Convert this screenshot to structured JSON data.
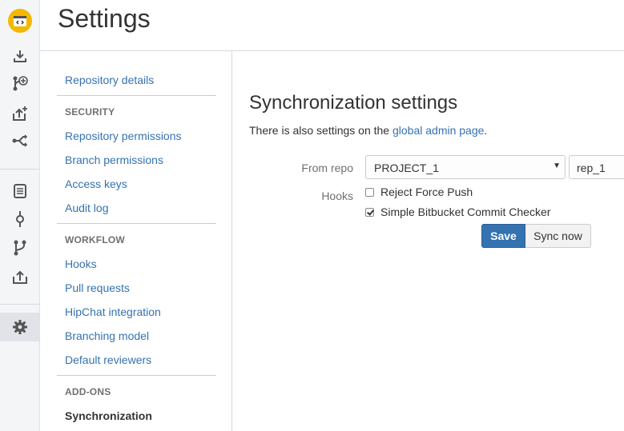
{
  "header": {
    "title": "Settings"
  },
  "rail": {
    "icons": [
      "bitbucket-logo-icon",
      "clone-icon",
      "create-branch-icon",
      "create-pull-request-icon",
      "fork-icon",
      "source-icon",
      "commits-icon",
      "branches-icon",
      "pull-requests-icon",
      "settings-gear-icon"
    ]
  },
  "nav": {
    "repository_details": "Repository details",
    "sections": [
      {
        "heading": "SECURITY",
        "items": [
          "Repository permissions",
          "Branch permissions",
          "Access keys",
          "Audit log"
        ]
      },
      {
        "heading": "WORKFLOW",
        "items": [
          "Hooks",
          "Pull requests",
          "HipChat integration",
          "Branching model",
          "Default reviewers"
        ]
      },
      {
        "heading": "ADD-ONS",
        "items": [
          "Synchronization"
        ]
      }
    ],
    "current": "Synchronization"
  },
  "main": {
    "title": "Synchronization settings",
    "info_prefix": "There is also settings on the ",
    "info_link": "global admin page",
    "info_suffix": ".",
    "from_repo_label": "From repo",
    "project_value": "PROJECT_1",
    "repo_value": "rep_1",
    "hooks_label": "Hooks",
    "hooks": [
      {
        "label": "Reject Force Push",
        "checked": false
      },
      {
        "label": "Simple Bitbucket Commit Checker",
        "checked": true
      }
    ],
    "save_label": "Save",
    "sync_label": "Sync now"
  },
  "colors": {
    "accent": "#3572b0",
    "logo": "#f5b700"
  }
}
